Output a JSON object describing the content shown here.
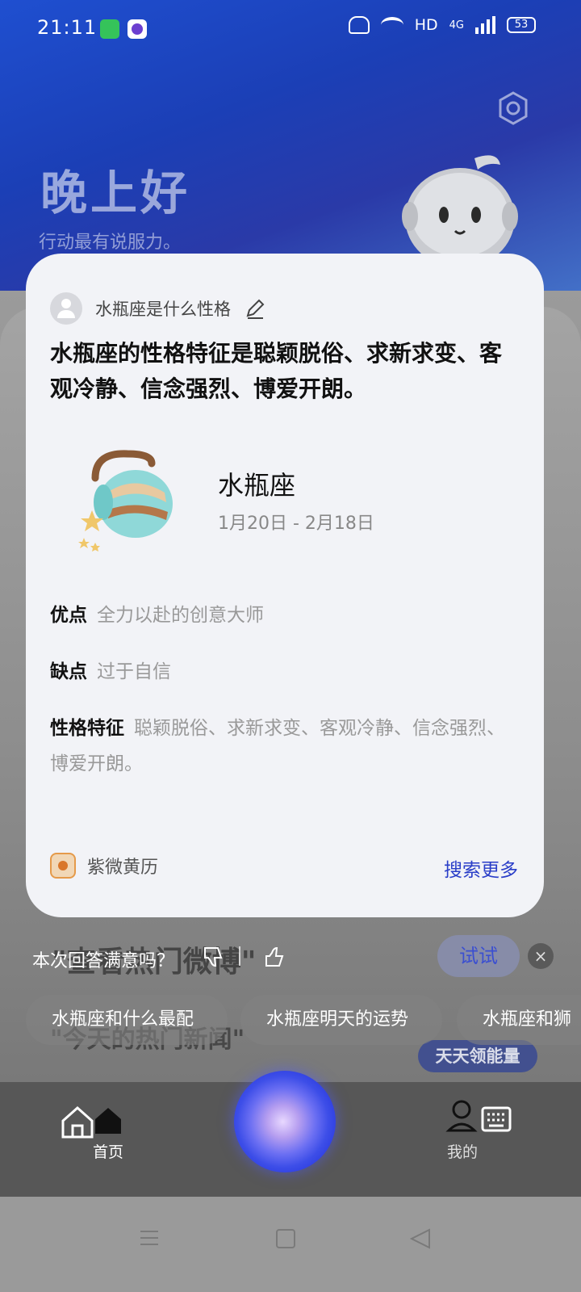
{
  "status_bar": {
    "time": "21:11",
    "network": "HD",
    "signal": "4G",
    "battery": "53"
  },
  "home": {
    "greeting": "晚上好",
    "motto": "行动最有说服力。"
  },
  "card": {
    "question": "水瓶座是什么性格",
    "answer": "水瓶座的性格特征是聪颖脱俗、求新求变、客观冷静、信念强烈、博爱开朗。",
    "zodiac": {
      "name": "水瓶座",
      "dates": "1月20日 - 2月18日"
    },
    "details": [
      {
        "label": "优点",
        "value": "全力以赴的创意大师"
      },
      {
        "label": "缺点",
        "value": "过于自信"
      },
      {
        "label": "性格特征",
        "value": "聪颖脱俗、求新求变、客观冷静、信念强烈、博爱开朗。"
      }
    ],
    "source": "紫微黄历",
    "search_more": "搜索更多"
  },
  "feedback": {
    "prompt": "本次回答满意吗？",
    "background_hint": "\"查看热门微博\""
  },
  "try_button": "试试",
  "close_symbol": "×",
  "suggestions": [
    "水瓶座和什么最配",
    "水瓶座明天的运势",
    "水瓶座和狮"
  ],
  "background_hint2": "\"今天的热门新闻\"",
  "energy_badge": "天天领能量",
  "bottom_nav": {
    "home_label": "首页",
    "me_label": "我的"
  },
  "colors": {
    "accent": "#2a3ec8",
    "card_bg": "#f2f3f7"
  }
}
